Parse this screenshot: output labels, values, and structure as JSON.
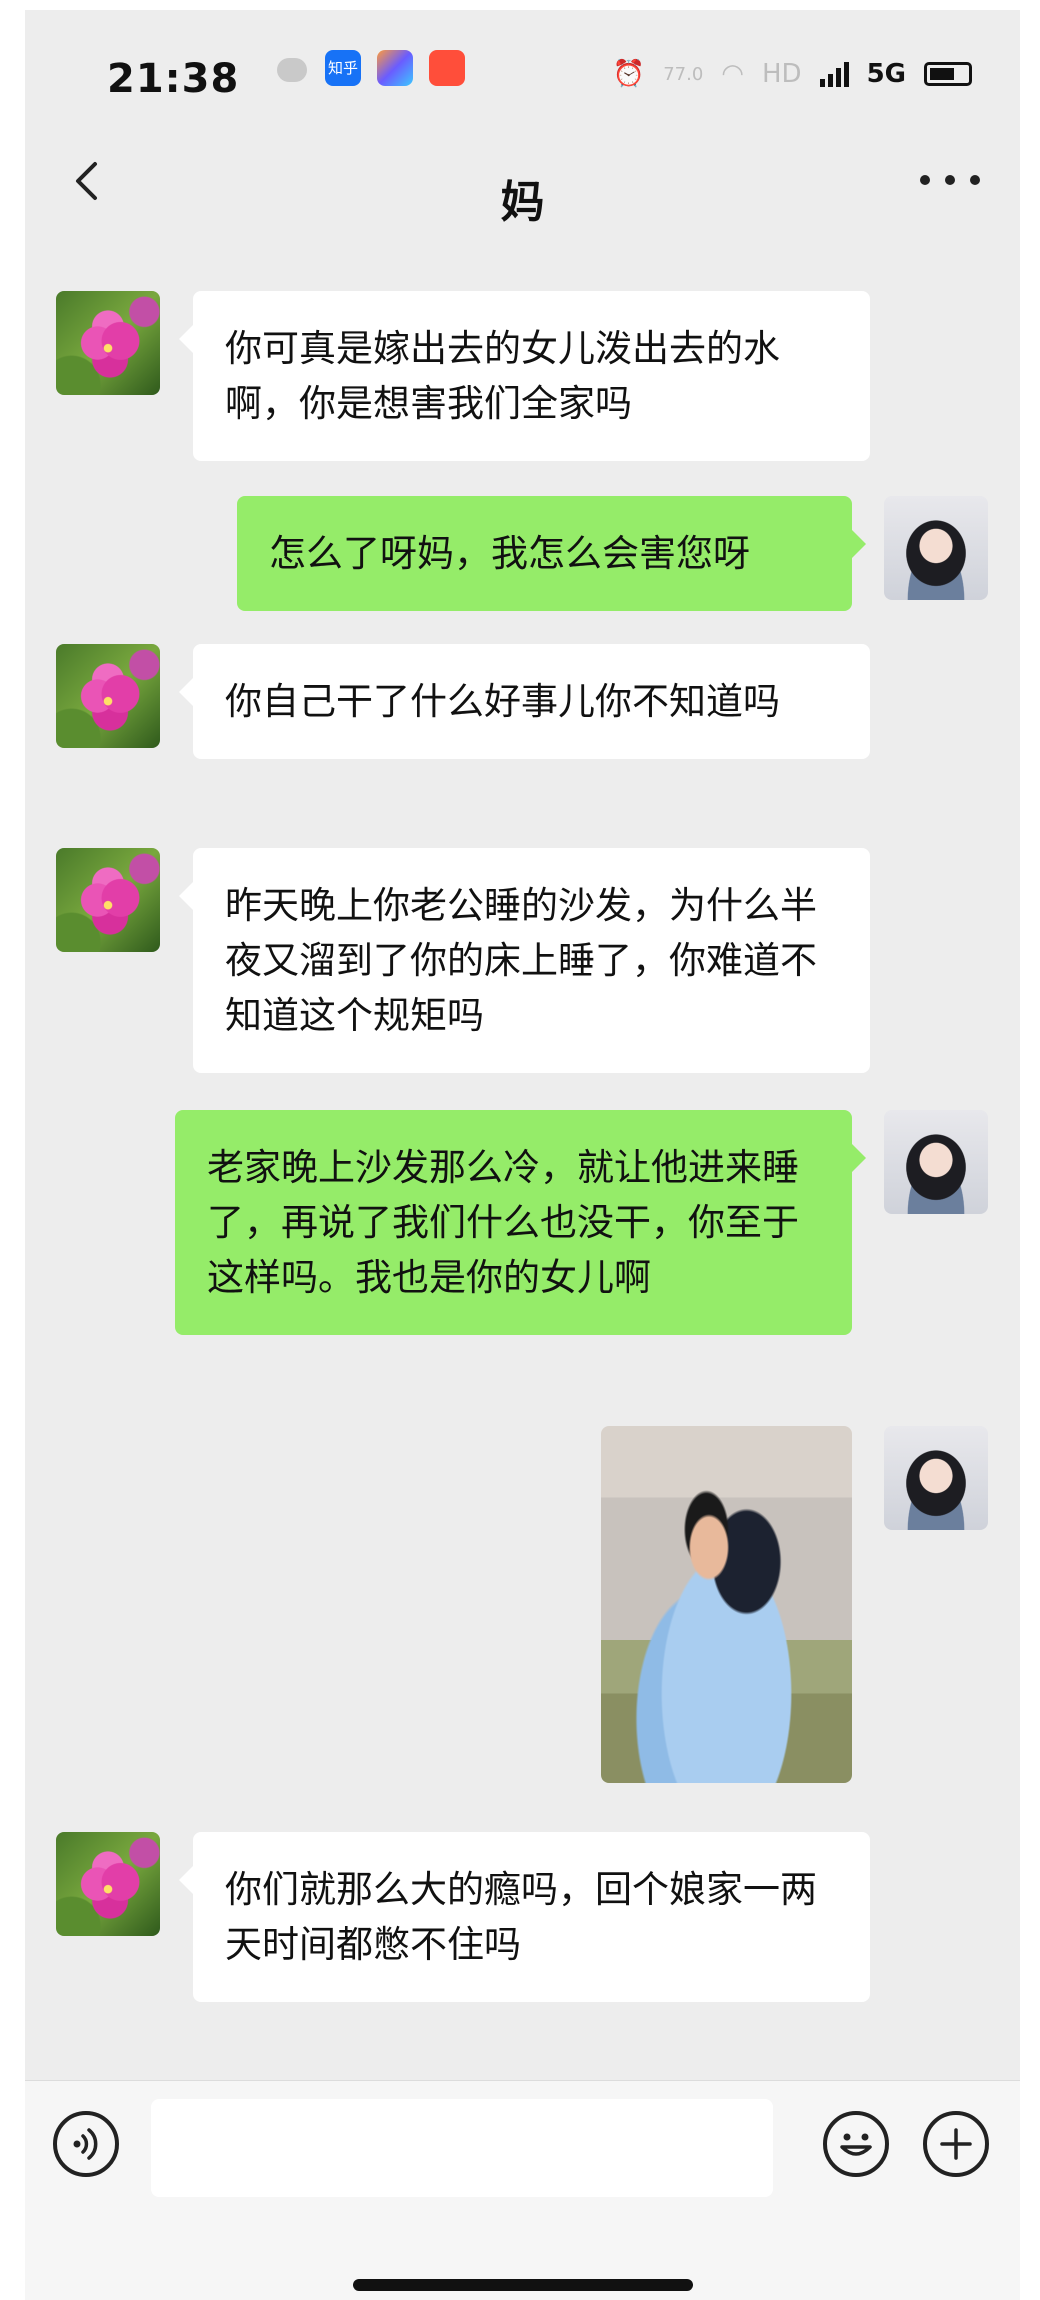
{
  "status_bar": {
    "time": "21:38",
    "apps": [
      {
        "name": "知乎",
        "color": "#1772f6"
      },
      {
        "name": "",
        "color": "#6a5cff"
      },
      {
        "name": "",
        "color": "#ff4e3a"
      }
    ],
    "network": "HD",
    "speed": "77.0",
    "signal_type": "5G"
  },
  "header": {
    "title": "妈"
  },
  "messages": [
    {
      "sender": "mom",
      "type": "text",
      "text": "你可真是嫁出去的女儿泼出去的水啊，你是想害我们全家吗"
    },
    {
      "sender": "me",
      "type": "text",
      "text": "怎么了呀妈，我怎么会害您呀"
    },
    {
      "sender": "mom",
      "type": "text",
      "text": "你自己干了什么好事儿你不知道吗"
    },
    {
      "sender": "mom",
      "type": "text",
      "text": "昨天晚上你老公睡的沙发，为什么半夜又溜到了你的床上睡了，你难道不知道这个规矩吗"
    },
    {
      "sender": "me",
      "type": "text",
      "text": "老家晚上沙发那么冷，就让他进来睡了，再说了我们什么也没干，你至于这样吗。我也是你的女儿啊"
    },
    {
      "sender": "me",
      "type": "image"
    },
    {
      "sender": "mom",
      "type": "text",
      "text": "你们就那么大的瘾吗，回个娘家一两天时间都憋不住吗"
    }
  ],
  "input_bar": {
    "placeholder": "",
    "value": ""
  },
  "colors": {
    "chat_background": "#ededed",
    "incoming_bubble": "#ffffff",
    "outgoing_bubble": "#95ec69"
  }
}
